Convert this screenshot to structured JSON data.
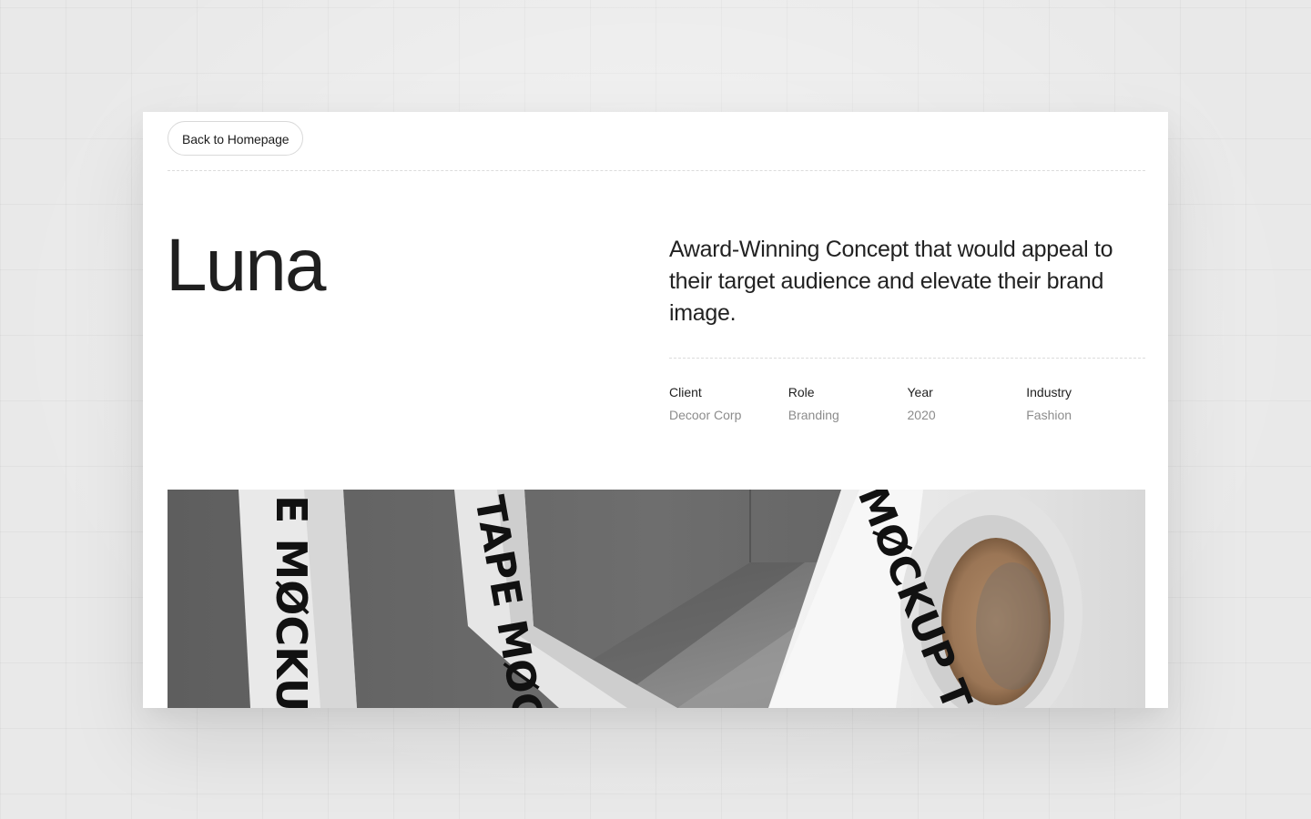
{
  "nav": {
    "back_label": "Back to Homepage"
  },
  "project": {
    "title": "Luna",
    "tagline": "Award-Winning Concept that would appeal to their target audience and elevate their brand image."
  },
  "meta": [
    {
      "label": "Client",
      "value": "Decoor Corp"
    },
    {
      "label": "Role",
      "value": "Branding"
    },
    {
      "label": "Year",
      "value": "2020"
    },
    {
      "label": "Industry",
      "value": "Fashion"
    }
  ],
  "hero": {
    "strip_left_text": "E MØCKU",
    "strip_mid_text": "TAPE MØCKUP",
    "roll_text": "MØCKUP TA"
  },
  "colors": {
    "background": "#e9e9e9",
    "surface": "#ffffff",
    "text_primary": "#1f1f1f",
    "text_muted": "#8c8c8c",
    "border": "#d9d9d9"
  }
}
